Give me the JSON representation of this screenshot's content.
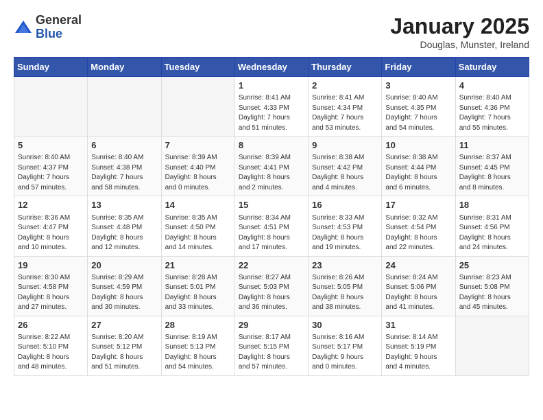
{
  "header": {
    "logo_general": "General",
    "logo_blue": "Blue",
    "month_title": "January 2025",
    "location": "Douglas, Munster, Ireland"
  },
  "days_of_week": [
    "Sunday",
    "Monday",
    "Tuesday",
    "Wednesday",
    "Thursday",
    "Friday",
    "Saturday"
  ],
  "weeks": [
    [
      {
        "day": "",
        "info": ""
      },
      {
        "day": "",
        "info": ""
      },
      {
        "day": "",
        "info": ""
      },
      {
        "day": "1",
        "info": "Sunrise: 8:41 AM\nSunset: 4:33 PM\nDaylight: 7 hours\nand 51 minutes."
      },
      {
        "day": "2",
        "info": "Sunrise: 8:41 AM\nSunset: 4:34 PM\nDaylight: 7 hours\nand 53 minutes."
      },
      {
        "day": "3",
        "info": "Sunrise: 8:40 AM\nSunset: 4:35 PM\nDaylight: 7 hours\nand 54 minutes."
      },
      {
        "day": "4",
        "info": "Sunrise: 8:40 AM\nSunset: 4:36 PM\nDaylight: 7 hours\nand 55 minutes."
      }
    ],
    [
      {
        "day": "5",
        "info": "Sunrise: 8:40 AM\nSunset: 4:37 PM\nDaylight: 7 hours\nand 57 minutes."
      },
      {
        "day": "6",
        "info": "Sunrise: 8:40 AM\nSunset: 4:38 PM\nDaylight: 7 hours\nand 58 minutes."
      },
      {
        "day": "7",
        "info": "Sunrise: 8:39 AM\nSunset: 4:40 PM\nDaylight: 8 hours\nand 0 minutes."
      },
      {
        "day": "8",
        "info": "Sunrise: 8:39 AM\nSunset: 4:41 PM\nDaylight: 8 hours\nand 2 minutes."
      },
      {
        "day": "9",
        "info": "Sunrise: 8:38 AM\nSunset: 4:42 PM\nDaylight: 8 hours\nand 4 minutes."
      },
      {
        "day": "10",
        "info": "Sunrise: 8:38 AM\nSunset: 4:44 PM\nDaylight: 8 hours\nand 6 minutes."
      },
      {
        "day": "11",
        "info": "Sunrise: 8:37 AM\nSunset: 4:45 PM\nDaylight: 8 hours\nand 8 minutes."
      }
    ],
    [
      {
        "day": "12",
        "info": "Sunrise: 8:36 AM\nSunset: 4:47 PM\nDaylight: 8 hours\nand 10 minutes."
      },
      {
        "day": "13",
        "info": "Sunrise: 8:35 AM\nSunset: 4:48 PM\nDaylight: 8 hours\nand 12 minutes."
      },
      {
        "day": "14",
        "info": "Sunrise: 8:35 AM\nSunset: 4:50 PM\nDaylight: 8 hours\nand 14 minutes."
      },
      {
        "day": "15",
        "info": "Sunrise: 8:34 AM\nSunset: 4:51 PM\nDaylight: 8 hours\nand 17 minutes."
      },
      {
        "day": "16",
        "info": "Sunrise: 8:33 AM\nSunset: 4:53 PM\nDaylight: 8 hours\nand 19 minutes."
      },
      {
        "day": "17",
        "info": "Sunrise: 8:32 AM\nSunset: 4:54 PM\nDaylight: 8 hours\nand 22 minutes."
      },
      {
        "day": "18",
        "info": "Sunrise: 8:31 AM\nSunset: 4:56 PM\nDaylight: 8 hours\nand 24 minutes."
      }
    ],
    [
      {
        "day": "19",
        "info": "Sunrise: 8:30 AM\nSunset: 4:58 PM\nDaylight: 8 hours\nand 27 minutes."
      },
      {
        "day": "20",
        "info": "Sunrise: 8:29 AM\nSunset: 4:59 PM\nDaylight: 8 hours\nand 30 minutes."
      },
      {
        "day": "21",
        "info": "Sunrise: 8:28 AM\nSunset: 5:01 PM\nDaylight: 8 hours\nand 33 minutes."
      },
      {
        "day": "22",
        "info": "Sunrise: 8:27 AM\nSunset: 5:03 PM\nDaylight: 8 hours\nand 36 minutes."
      },
      {
        "day": "23",
        "info": "Sunrise: 8:26 AM\nSunset: 5:05 PM\nDaylight: 8 hours\nand 38 minutes."
      },
      {
        "day": "24",
        "info": "Sunrise: 8:24 AM\nSunset: 5:06 PM\nDaylight: 8 hours\nand 41 minutes."
      },
      {
        "day": "25",
        "info": "Sunrise: 8:23 AM\nSunset: 5:08 PM\nDaylight: 8 hours\nand 45 minutes."
      }
    ],
    [
      {
        "day": "26",
        "info": "Sunrise: 8:22 AM\nSunset: 5:10 PM\nDaylight: 8 hours\nand 48 minutes."
      },
      {
        "day": "27",
        "info": "Sunrise: 8:20 AM\nSunset: 5:12 PM\nDaylight: 8 hours\nand 51 minutes."
      },
      {
        "day": "28",
        "info": "Sunrise: 8:19 AM\nSunset: 5:13 PM\nDaylight: 8 hours\nand 54 minutes."
      },
      {
        "day": "29",
        "info": "Sunrise: 8:17 AM\nSunset: 5:15 PM\nDaylight: 8 hours\nand 57 minutes."
      },
      {
        "day": "30",
        "info": "Sunrise: 8:16 AM\nSunset: 5:17 PM\nDaylight: 9 hours\nand 0 minutes."
      },
      {
        "day": "31",
        "info": "Sunrise: 8:14 AM\nSunset: 5:19 PM\nDaylight: 9 hours\nand 4 minutes."
      },
      {
        "day": "",
        "info": ""
      }
    ]
  ]
}
